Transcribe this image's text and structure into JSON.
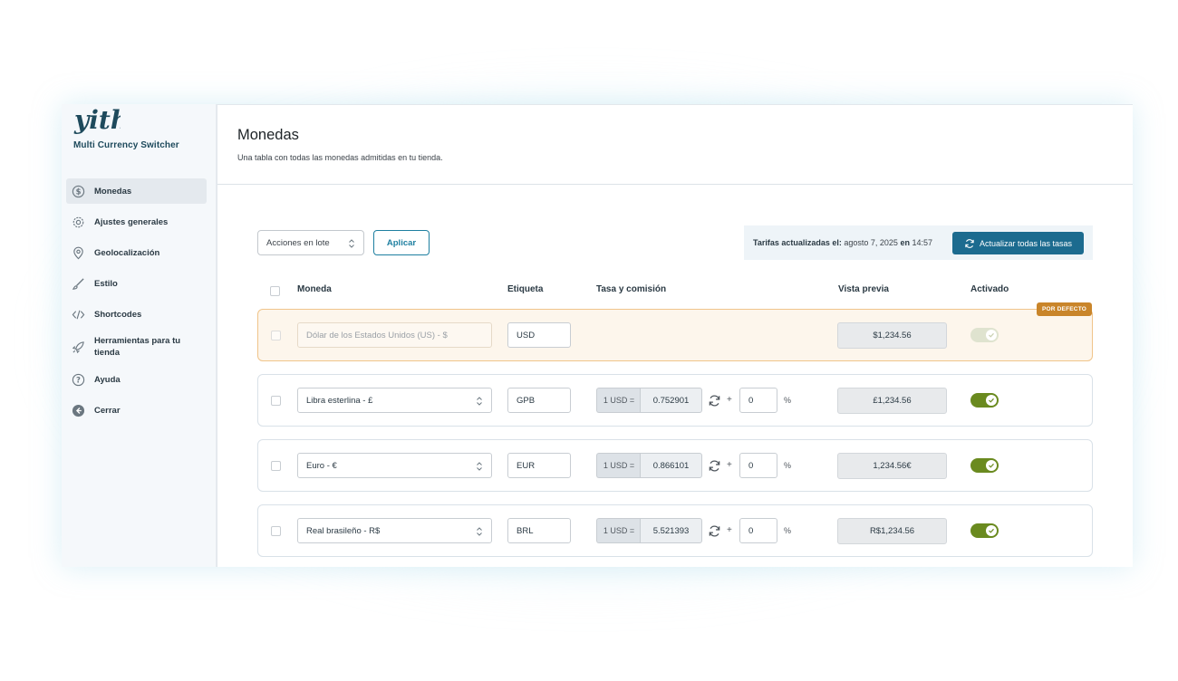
{
  "brand": {
    "name": "Multi Currency Switcher",
    "logo_icon": "yith-logo"
  },
  "sidebar": {
    "items": [
      {
        "label": "Monedas",
        "icon": "dollar-circle-icon",
        "active": true
      },
      {
        "label": "Ajustes generales",
        "icon": "gear-icon"
      },
      {
        "label": "Geolocalización",
        "icon": "map-pin-icon"
      },
      {
        "label": "Estilo",
        "icon": "brush-icon"
      },
      {
        "label": "Shortcodes",
        "icon": "code-icon"
      },
      {
        "label": "Herramientas para tu tienda",
        "icon": "rocket-icon"
      },
      {
        "label": "Ayuda",
        "icon": "help-icon"
      },
      {
        "label": "Cerrar",
        "icon": "arrow-left-circle-icon"
      }
    ]
  },
  "page": {
    "title": "Monedas",
    "description": "Una tabla con todas las monedas admitidas en tu tienda."
  },
  "toolbar": {
    "bulk_actions": "Acciones en lote",
    "apply": "Aplicar",
    "rates_label": "Tarifas actualizadas el:",
    "rates_date": "agosto 7, 2025",
    "rates_at": "en",
    "rates_time": "14:57",
    "update_all": "Actualizar todas las tasas"
  },
  "table": {
    "headers": {
      "currency": "Moneda",
      "label": "Etiqueta",
      "rate": "Tasa y comisión",
      "preview": "Vista previa",
      "enabled": "Activado"
    },
    "default_badge": "POR DEFECTO",
    "rows": [
      {
        "currency": "Dólar de los Estados Unidos (US) - $",
        "label": "USD",
        "preview": "$1,234.56",
        "enabled": true,
        "default": true
      },
      {
        "currency": "Libra esterlina - £",
        "label": "GPB",
        "rate_prefix": "1 USD =",
        "rate": "0.752901",
        "plus": "+",
        "fee": "0",
        "pct": "%",
        "preview": "£1,234.56",
        "enabled": true
      },
      {
        "currency": "Euro - €",
        "label": "EUR",
        "rate_prefix": "1 USD =",
        "rate": "0.866101",
        "plus": "+",
        "fee": "0",
        "pct": "%",
        "preview": "1,234.56€",
        "enabled": true
      },
      {
        "currency": "Real brasileño - R$",
        "label": "BRL",
        "rate_prefix": "1 USD =",
        "rate": "5.521393",
        "plus": "+",
        "fee": "0",
        "pct": "%",
        "preview": "R$1,234.56",
        "enabled": true
      }
    ]
  },
  "colors": {
    "accent": "#1c6b8f",
    "toggle_on": "#6a8a1f",
    "default_badge": "#c9852a"
  }
}
